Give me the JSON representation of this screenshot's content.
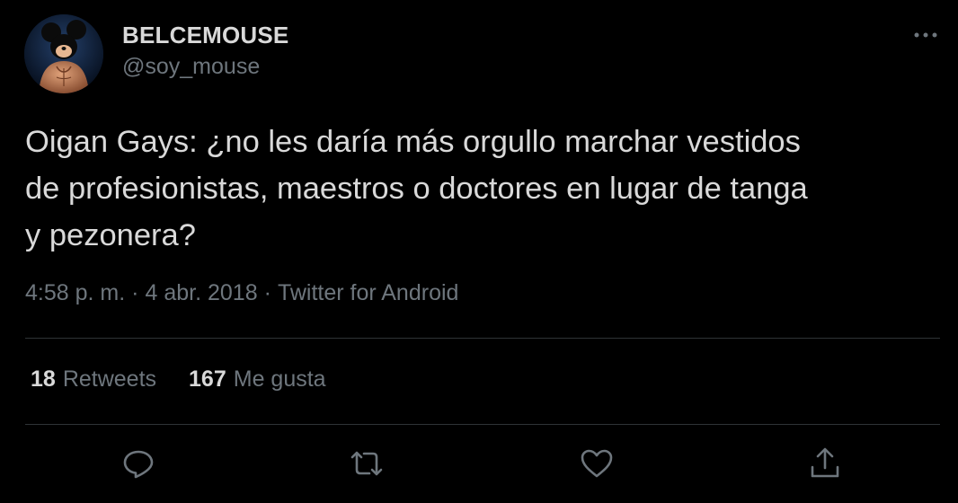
{
  "tweet": {
    "display_name": "BELCEMOUSE",
    "handle": "@soy_mouse",
    "text": "Oigan Gays: ¿no les daría más orgullo marchar vestidos\nde profesionistas, maestros o doctores en lugar de tanga\ny pezonera?",
    "time": "4:58 p. m.",
    "separator": "·",
    "date": "4 abr. 2018",
    "source": "Twitter for Android"
  },
  "stats": {
    "retweets_count": "18",
    "retweets_label": "Retweets",
    "likes_count": "167",
    "likes_label": "Me gusta"
  },
  "icons": {
    "avatar": "mickey-mouse-muscular-avatar",
    "more": "more-horizontal-icon",
    "reply": "reply-icon",
    "retweet": "retweet-icon",
    "like": "heart-icon",
    "share": "share-icon"
  },
  "colors": {
    "background": "#000000",
    "primary_text": "#d9d9d9",
    "secondary_text": "#6e767d",
    "divider": "#2f3336"
  }
}
